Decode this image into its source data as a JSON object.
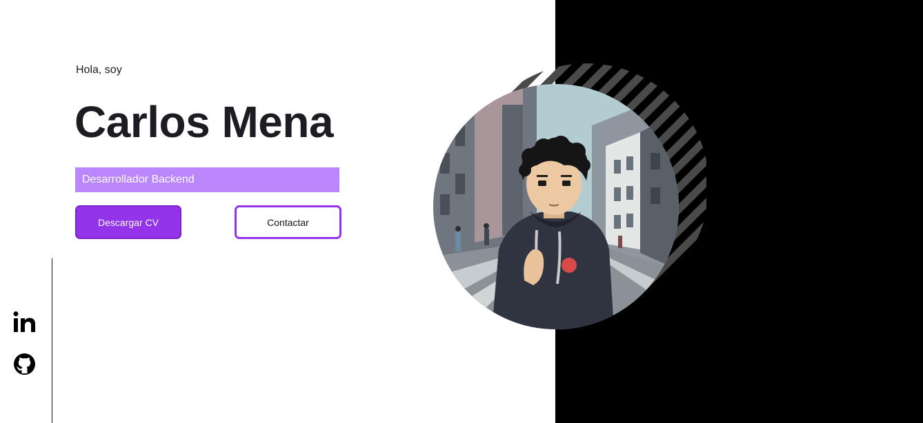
{
  "hero": {
    "greeting": "Hola, soy",
    "name": "Carlos Mena",
    "role": "Desarrollador Backend"
  },
  "buttons": {
    "download_cv": "Descargar CV",
    "contact": "Contactar"
  },
  "social": {
    "icons": [
      "linkedin-icon",
      "github-icon"
    ]
  },
  "colors": {
    "accent": "#9333ea",
    "role_bg": "#bb86fc",
    "panel_bg": "#000000",
    "text": "#1c1c22"
  }
}
